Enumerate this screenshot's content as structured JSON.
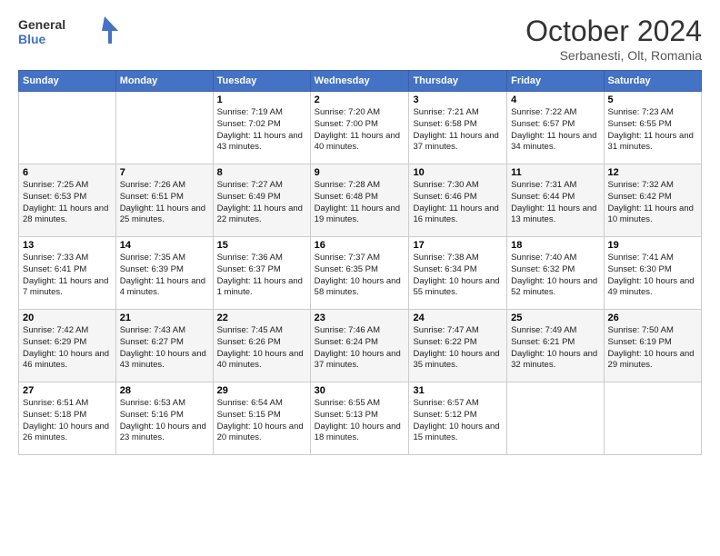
{
  "logo": {
    "general": "General",
    "blue": "Blue"
  },
  "header": {
    "month": "October 2024",
    "location": "Serbanesti, Olt, Romania"
  },
  "weekdays": [
    "Sunday",
    "Monday",
    "Tuesday",
    "Wednesday",
    "Thursday",
    "Friday",
    "Saturday"
  ],
  "weeks": [
    [
      {
        "day": "",
        "info": ""
      },
      {
        "day": "",
        "info": ""
      },
      {
        "day": "1",
        "info": "Sunrise: 7:19 AM\nSunset: 7:02 PM\nDaylight: 11 hours and 43 minutes."
      },
      {
        "day": "2",
        "info": "Sunrise: 7:20 AM\nSunset: 7:00 PM\nDaylight: 11 hours and 40 minutes."
      },
      {
        "day": "3",
        "info": "Sunrise: 7:21 AM\nSunset: 6:58 PM\nDaylight: 11 hours and 37 minutes."
      },
      {
        "day": "4",
        "info": "Sunrise: 7:22 AM\nSunset: 6:57 PM\nDaylight: 11 hours and 34 minutes."
      },
      {
        "day": "5",
        "info": "Sunrise: 7:23 AM\nSunset: 6:55 PM\nDaylight: 11 hours and 31 minutes."
      }
    ],
    [
      {
        "day": "6",
        "info": "Sunrise: 7:25 AM\nSunset: 6:53 PM\nDaylight: 11 hours and 28 minutes."
      },
      {
        "day": "7",
        "info": "Sunrise: 7:26 AM\nSunset: 6:51 PM\nDaylight: 11 hours and 25 minutes."
      },
      {
        "day": "8",
        "info": "Sunrise: 7:27 AM\nSunset: 6:49 PM\nDaylight: 11 hours and 22 minutes."
      },
      {
        "day": "9",
        "info": "Sunrise: 7:28 AM\nSunset: 6:48 PM\nDaylight: 11 hours and 19 minutes."
      },
      {
        "day": "10",
        "info": "Sunrise: 7:30 AM\nSunset: 6:46 PM\nDaylight: 11 hours and 16 minutes."
      },
      {
        "day": "11",
        "info": "Sunrise: 7:31 AM\nSunset: 6:44 PM\nDaylight: 11 hours and 13 minutes."
      },
      {
        "day": "12",
        "info": "Sunrise: 7:32 AM\nSunset: 6:42 PM\nDaylight: 11 hours and 10 minutes."
      }
    ],
    [
      {
        "day": "13",
        "info": "Sunrise: 7:33 AM\nSunset: 6:41 PM\nDaylight: 11 hours and 7 minutes."
      },
      {
        "day": "14",
        "info": "Sunrise: 7:35 AM\nSunset: 6:39 PM\nDaylight: 11 hours and 4 minutes."
      },
      {
        "day": "15",
        "info": "Sunrise: 7:36 AM\nSunset: 6:37 PM\nDaylight: 11 hours and 1 minute."
      },
      {
        "day": "16",
        "info": "Sunrise: 7:37 AM\nSunset: 6:35 PM\nDaylight: 10 hours and 58 minutes."
      },
      {
        "day": "17",
        "info": "Sunrise: 7:38 AM\nSunset: 6:34 PM\nDaylight: 10 hours and 55 minutes."
      },
      {
        "day": "18",
        "info": "Sunrise: 7:40 AM\nSunset: 6:32 PM\nDaylight: 10 hours and 52 minutes."
      },
      {
        "day": "19",
        "info": "Sunrise: 7:41 AM\nSunset: 6:30 PM\nDaylight: 10 hours and 49 minutes."
      }
    ],
    [
      {
        "day": "20",
        "info": "Sunrise: 7:42 AM\nSunset: 6:29 PM\nDaylight: 10 hours and 46 minutes."
      },
      {
        "day": "21",
        "info": "Sunrise: 7:43 AM\nSunset: 6:27 PM\nDaylight: 10 hours and 43 minutes."
      },
      {
        "day": "22",
        "info": "Sunrise: 7:45 AM\nSunset: 6:26 PM\nDaylight: 10 hours and 40 minutes."
      },
      {
        "day": "23",
        "info": "Sunrise: 7:46 AM\nSunset: 6:24 PM\nDaylight: 10 hours and 37 minutes."
      },
      {
        "day": "24",
        "info": "Sunrise: 7:47 AM\nSunset: 6:22 PM\nDaylight: 10 hours and 35 minutes."
      },
      {
        "day": "25",
        "info": "Sunrise: 7:49 AM\nSunset: 6:21 PM\nDaylight: 10 hours and 32 minutes."
      },
      {
        "day": "26",
        "info": "Sunrise: 7:50 AM\nSunset: 6:19 PM\nDaylight: 10 hours and 29 minutes."
      }
    ],
    [
      {
        "day": "27",
        "info": "Sunrise: 6:51 AM\nSunset: 5:18 PM\nDaylight: 10 hours and 26 minutes."
      },
      {
        "day": "28",
        "info": "Sunrise: 6:53 AM\nSunset: 5:16 PM\nDaylight: 10 hours and 23 minutes."
      },
      {
        "day": "29",
        "info": "Sunrise: 6:54 AM\nSunset: 5:15 PM\nDaylight: 10 hours and 20 minutes."
      },
      {
        "day": "30",
        "info": "Sunrise: 6:55 AM\nSunset: 5:13 PM\nDaylight: 10 hours and 18 minutes."
      },
      {
        "day": "31",
        "info": "Sunrise: 6:57 AM\nSunset: 5:12 PM\nDaylight: 10 hours and 15 minutes."
      },
      {
        "day": "",
        "info": ""
      },
      {
        "day": "",
        "info": ""
      }
    ]
  ]
}
